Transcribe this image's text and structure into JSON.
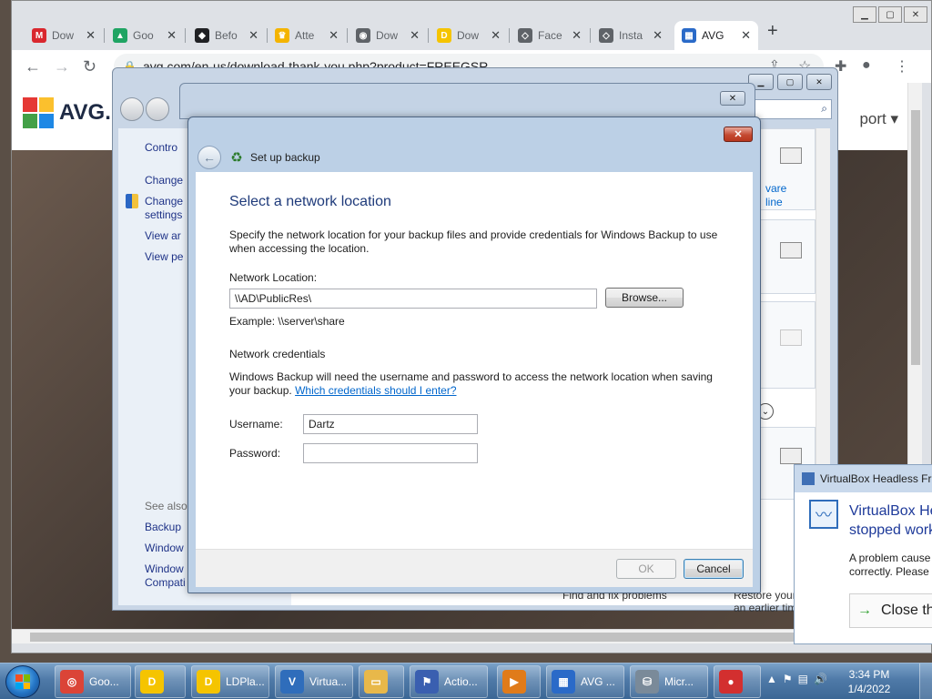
{
  "browser": {
    "tabs": [
      {
        "label": "Dow",
        "icon": "mega-icon",
        "color": "#d9272e",
        "glyph": "M"
      },
      {
        "label": "Goo",
        "icon": "google-drive-icon",
        "color": "#1fa463",
        "glyph": "▲"
      },
      {
        "label": "Befo",
        "icon": "shield-icon",
        "color": "#202124",
        "glyph": "◆"
      },
      {
        "label": "Atte",
        "icon": "crown-icon",
        "color": "#f4b400",
        "glyph": "♛"
      },
      {
        "label": "Dow",
        "icon": "globe-icon",
        "color": "#5f6368",
        "glyph": "◉"
      },
      {
        "label": "Dow",
        "icon": "ldplayer-icon",
        "color": "#f5c400",
        "glyph": "D"
      },
      {
        "label": "Face",
        "icon": "diamond-arrows-icon",
        "color": "#5f6368",
        "glyph": "◇"
      },
      {
        "label": "Insta",
        "icon": "diamond-arrows-icon",
        "color": "#5f6368",
        "glyph": "◇"
      },
      {
        "label": "AVG",
        "icon": "avg-icon",
        "color": "#2a6ac8",
        "glyph": "▦"
      }
    ],
    "url": "avg.com/en-us/download-thank-you.php?product=FREEGSR",
    "page": {
      "logo_text": "AVG.",
      "support_text": "port ▾"
    }
  },
  "control_panel": {
    "left_items": [
      "Contro",
      "Change",
      "Change",
      "settings",
      "View ar",
      "View pe"
    ],
    "see_also_label": "See also",
    "see_also_items": [
      "Backup",
      "Window",
      "Window",
      "Compati"
    ],
    "right_texts": {
      "link1": "vare",
      "link2": "line",
      "find_fix": "Find and fix problems",
      "restore1": "Restore your computer to",
      "restore2": "an earlier time"
    }
  },
  "dialog": {
    "title": "Set up backup",
    "heading": "Select a network location",
    "intro": "Specify the network location for your backup files and provide credentials for Windows Backup to use when accessing the location.",
    "network_location_label": "Network Location:",
    "network_location_value": "\\\\AD\\PublicRes\\",
    "browse_label": "Browse...",
    "example_text": "Example: \\\\server\\share",
    "credentials_heading": "Network credentials",
    "credentials_text": "Windows Backup will need the username and password to access the network location when saving your backup.",
    "credentials_link": "Which credentials should I enter?",
    "username_label": "Username:",
    "username_value": "Dartz",
    "password_label": "Password:",
    "password_value": "",
    "ok_label": "OK",
    "cancel_label": "Cancel"
  },
  "virtualbox": {
    "title": "VirtualBox Headless Fro",
    "heading_line1": "VirtualBox He",
    "heading_line2": "stopped work",
    "body_line1": "A problem cause",
    "body_line2": "correctly. Please c",
    "close_label": "Close the"
  },
  "taskbar": {
    "items": [
      {
        "label": "Goo...",
        "icon": "chrome-icon",
        "color": "#db4437"
      },
      {
        "label": "",
        "icon": "ldplayer-icon",
        "color": "#f5c400"
      },
      {
        "label": "LDPla...",
        "icon": "ldplayer-icon",
        "color": "#f5c400"
      },
      {
        "label": "Virtua...",
        "icon": "virtualbox-icon",
        "color": "#2f6dbb"
      },
      {
        "label": "",
        "icon": "folder-icon",
        "color": "#e8b84a"
      },
      {
        "label": "Actio...",
        "icon": "action-center-flag-icon",
        "color": "#3a5fb0"
      },
      {
        "label": "",
        "icon": "media-player-icon",
        "color": "#e07b1a"
      },
      {
        "label": "AVG ...",
        "icon": "avg-icon",
        "color": "#2a6ac8"
      },
      {
        "label": "Micr...",
        "icon": "disk-tool-icon",
        "color": "#7a8a99"
      },
      {
        "label": "",
        "icon": "among-us-icon",
        "color": "#d32f2f"
      }
    ],
    "time": "3:34 PM",
    "date": "1/4/2022"
  }
}
